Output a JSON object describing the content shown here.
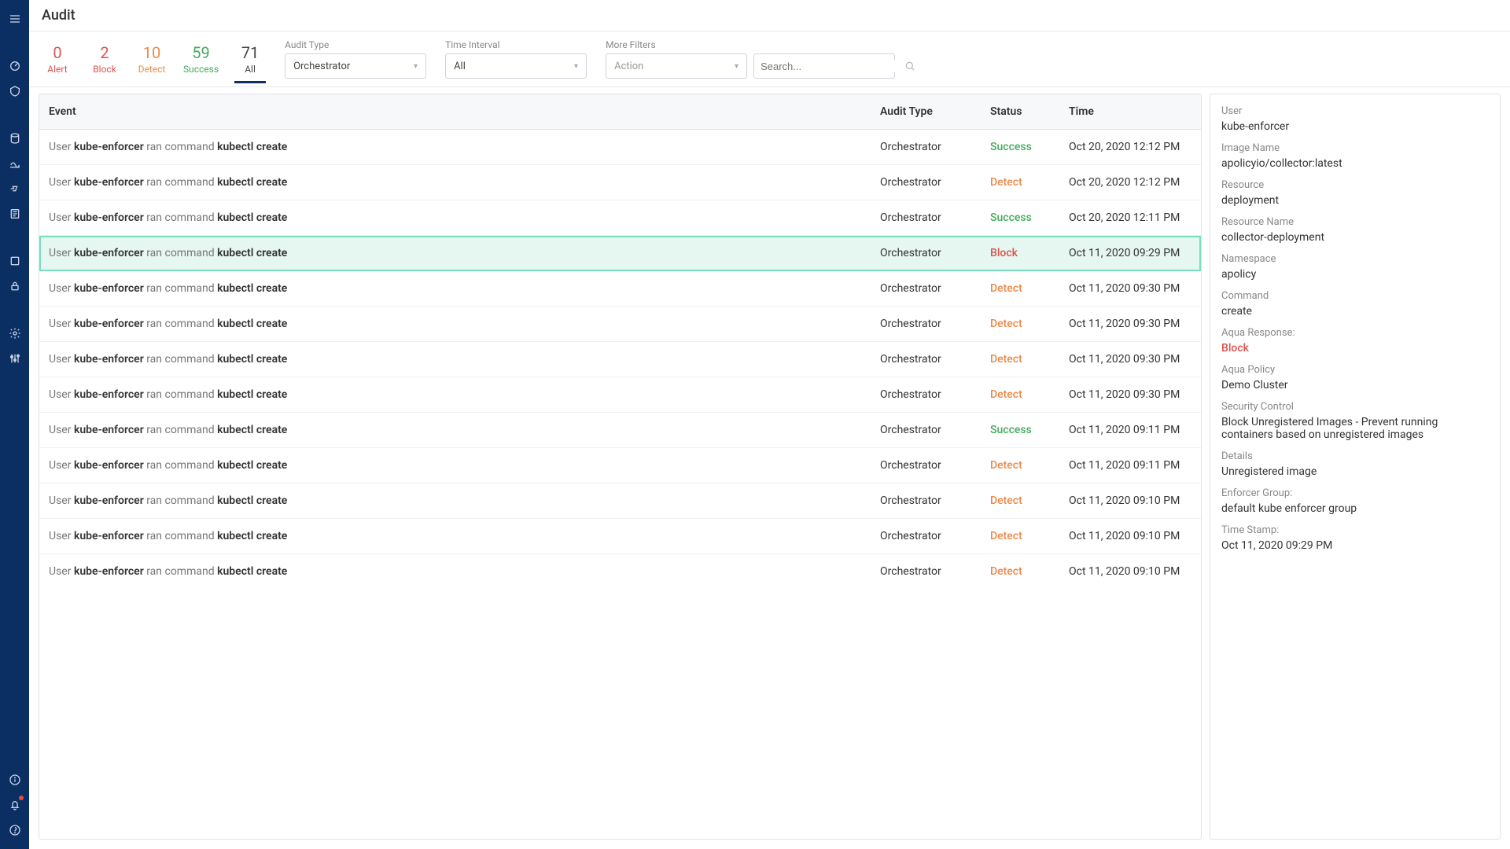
{
  "header": {
    "title": "Audit"
  },
  "filters": {
    "tabs": [
      {
        "count": "0",
        "label": "Alert",
        "cls": "alert"
      },
      {
        "count": "2",
        "label": "Block",
        "cls": "block"
      },
      {
        "count": "10",
        "label": "Detect",
        "cls": "detect"
      },
      {
        "count": "59",
        "label": "Success",
        "cls": "success"
      },
      {
        "count": "71",
        "label": "All",
        "cls": "all",
        "active": true
      }
    ],
    "auditType": {
      "label": "Audit Type",
      "value": "Orchestrator"
    },
    "timeInterval": {
      "label": "Time Interval",
      "value": "All"
    },
    "moreFilters": {
      "label": "More Filters",
      "value": "Action"
    },
    "search": {
      "placeholder": "Search..."
    }
  },
  "table": {
    "columns": {
      "event": "Event",
      "type": "Audit Type",
      "status": "Status",
      "time": "Time"
    },
    "eventTemplate": {
      "prefix": "User ",
      "user": "kube-enforcer",
      "mid": " ran command ",
      "cmd": "kubectl create"
    },
    "rows": [
      {
        "type": "Orchestrator",
        "status": "Success",
        "time": "Oct 20, 2020 12:12 PM"
      },
      {
        "type": "Orchestrator",
        "status": "Detect",
        "time": "Oct 20, 2020 12:12 PM"
      },
      {
        "type": "Orchestrator",
        "status": "Success",
        "time": "Oct 20, 2020 12:11 PM"
      },
      {
        "type": "Orchestrator",
        "status": "Block",
        "time": "Oct 11, 2020 09:29 PM",
        "selected": true
      },
      {
        "type": "Orchestrator",
        "status": "Detect",
        "time": "Oct 11, 2020 09:30 PM"
      },
      {
        "type": "Orchestrator",
        "status": "Detect",
        "time": "Oct 11, 2020 09:30 PM"
      },
      {
        "type": "Orchestrator",
        "status": "Detect",
        "time": "Oct 11, 2020 09:30 PM"
      },
      {
        "type": "Orchestrator",
        "status": "Detect",
        "time": "Oct 11, 2020 09:30 PM"
      },
      {
        "type": "Orchestrator",
        "status": "Success",
        "time": "Oct 11, 2020 09:11 PM"
      },
      {
        "type": "Orchestrator",
        "status": "Detect",
        "time": "Oct 11, 2020 09:11 PM"
      },
      {
        "type": "Orchestrator",
        "status": "Detect",
        "time": "Oct 11, 2020 09:10 PM"
      },
      {
        "type": "Orchestrator",
        "status": "Detect",
        "time": "Oct 11, 2020 09:10 PM"
      },
      {
        "type": "Orchestrator",
        "status": "Detect",
        "time": "Oct 11, 2020 09:10 PM"
      }
    ]
  },
  "details": {
    "fields": [
      {
        "label": "User",
        "value": "kube-enforcer"
      },
      {
        "label": "Image Name",
        "value": "apolicyio/collector:latest"
      },
      {
        "label": "Resource",
        "value": "deployment"
      },
      {
        "label": "Resource Name",
        "value": "collector-deployment"
      },
      {
        "label": "Namespace",
        "value": "apolicy"
      },
      {
        "label": "Command",
        "value": "create"
      },
      {
        "label": "Aqua Response:",
        "value": "Block",
        "cls": "block"
      },
      {
        "label": "Aqua Policy",
        "value": "Demo Cluster"
      },
      {
        "label": "Security Control",
        "value": "Block Unregistered Images - Prevent running containers based on unregistered images"
      },
      {
        "label": "Details",
        "value": "Unregistered image"
      },
      {
        "label": "Enforcer Group:",
        "value": "default kube enforcer group"
      },
      {
        "label": "Time Stamp:",
        "value": "Oct 11, 2020 09:29 PM"
      }
    ]
  },
  "icons": {
    "menu": "menu-icon",
    "dashboard": "dashboard-icon",
    "risk": "risk-icon",
    "images": "images-icon",
    "workloads": "workloads-icon",
    "functions": "functions-icon",
    "audit": "audit-icon",
    "enforcers": "enforcers-icon",
    "secrets": "secrets-icon",
    "settings": "settings-icon",
    "integrations": "integrations-icon",
    "info": "info-icon",
    "alerts": "alerts-icon",
    "about": "about-icon"
  }
}
